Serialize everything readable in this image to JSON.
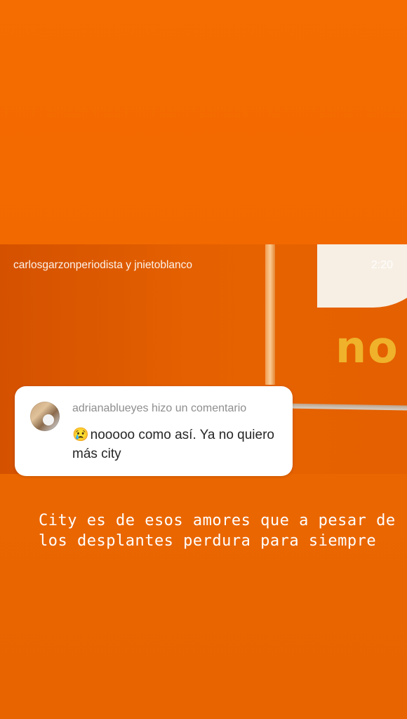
{
  "shared_post": {
    "authors": "carlosgarzonperiodista y jnietoblanco",
    "duration": "2:20",
    "video_logo_text": "no"
  },
  "comment": {
    "header": "adrianablueyes hizo un comentario",
    "emoji": "😢",
    "text": "nooooo como así. Ya no quiero más city"
  },
  "story_caption": "City es de esos amores que a pesar de los desplantes perdura para siempre",
  "colors": {
    "background": "#f26a00",
    "card": "#ffffff",
    "text_white": "#ffffff"
  }
}
